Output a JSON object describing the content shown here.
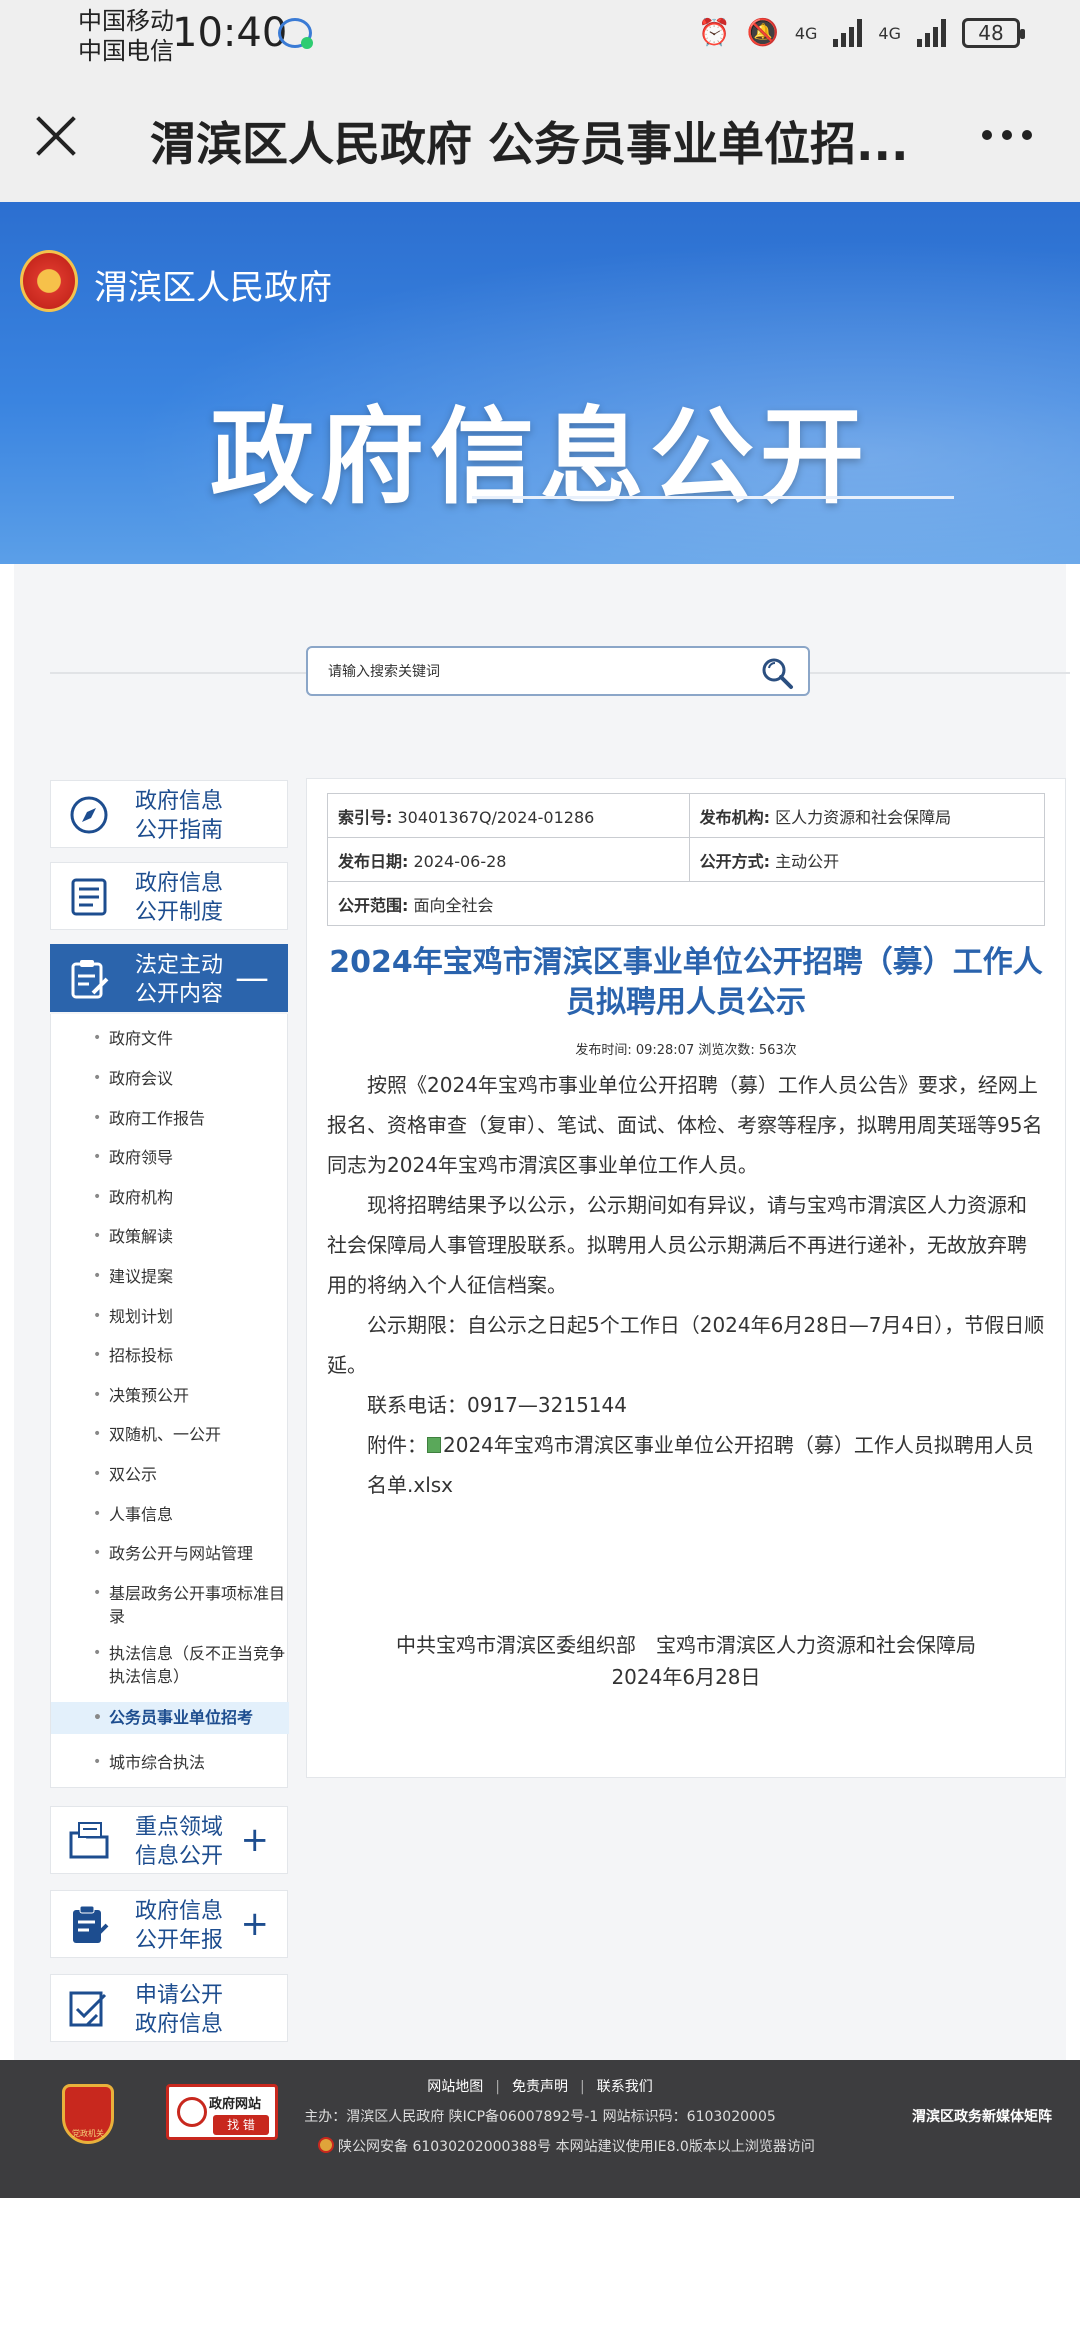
{
  "status_bar": {
    "carrier1": "中国移动",
    "carrier2": "中国电信",
    "time": "10:40",
    "network1": "4G",
    "network2": "4G",
    "battery": "48"
  },
  "browser": {
    "title": "渭滨区人民政府 公务员事业单位招..."
  },
  "banner": {
    "site_name": "渭滨区人民政府",
    "title": "政府信息公开"
  },
  "search": {
    "placeholder": "请输入搜索关键词"
  },
  "nav": {
    "cards": [
      {
        "label": "政府信息公开指南",
        "icon": "compass-icon"
      },
      {
        "label": "政府信息公开制度",
        "icon": "document-list-icon"
      },
      {
        "label": "法定主动公开内容",
        "icon": "clipboard-edit-icon",
        "toggle": "—"
      },
      {
        "label": "重点领域信息公开",
        "icon": "folder-file-icon",
        "toggle": "+"
      },
      {
        "label": "政府信息公开年报",
        "icon": "clipboard-report-icon",
        "toggle": "+"
      },
      {
        "label": "申请公开政府信息",
        "icon": "apply-check-icon"
      }
    ],
    "sub_items": [
      "政府文件",
      "政府会议",
      "政府工作报告",
      "政府领导",
      "政府机构",
      "政策解读",
      "建议提案",
      "规划计划",
      "招标投标",
      "决策预公开",
      "双随机、一公开",
      "双公示",
      "人事信息",
      "政务公开与网站管理",
      "基层政务公开事项标准目录",
      "执法信息（反不正当竞争执法信息）",
      "公务员事业单位招考",
      "城市综合执法"
    ]
  },
  "article": {
    "meta": {
      "index_label": "索引号:",
      "index_value": "30401367Q/2024-01286",
      "publisher_label": "发布机构:",
      "publisher_value": "区人力资源和社会保障局",
      "date_label": "发布日期:",
      "date_value": "2024-06-28",
      "mode_label": "公开方式:",
      "mode_value": "主动公开",
      "scope_label": "公开范围:",
      "scope_value": "面向全社会"
    },
    "title": "2024年宝鸡市渭滨区事业单位公开招聘（募）工作人员拟聘用人员公示",
    "stat": "发布时间: 09:28:07 浏览次数: 563次",
    "paragraphs": [
      "按照《2024年宝鸡市事业单位公开招聘（募）工作人员公告》要求，经网上报名、资格审查（复审）、笔试、面试、体检、考察等程序，拟聘用周芙瑶等95名同志为2024年宝鸡市渭滨区事业单位工作人员。",
      "现将招聘结果予以公示，公示期间如有异议，请与宝鸡市渭滨区人力资源和社会保障局人事管理股联系。拟聘用人员公示期满后不再进行递补，无故放弃聘用的将纳入个人征信档案。",
      "公示期限：自公示之日起5个工作日（2024年6月28日—7月4日），节假日顺延。",
      "联系电话：0917—3215144"
    ],
    "attachment_label": "附件：",
    "attachment_file": "2024年宝鸡市渭滨区事业单位公开招聘（募）工作人员拟聘用人员名单.xlsx",
    "sign_org": "中共宝鸡市渭滨区委组织部　宝鸡市渭滨区人力资源和社会保障局",
    "sign_date": "2024年6月28日"
  },
  "footer": {
    "party_logo_text": "党政机关",
    "find_error_title": "政府网站",
    "find_error_btn": "找 错",
    "links": [
      "网站地图",
      "免责声明",
      "联系我们"
    ],
    "line2": "主办：渭滨区人民政府 陕ICP备06007892号-1 网站标识码：6103020005",
    "line3": "陕公网安备 61030202000388号 本网站建议使用IE8.0版本以上浏览器访问",
    "matrix": "渭滨区政务新媒体矩阵"
  },
  "colors": {
    "accent": "#2b64ac",
    "title_blue": "#2a63ad",
    "footer_bg": "#3d3d3f"
  }
}
